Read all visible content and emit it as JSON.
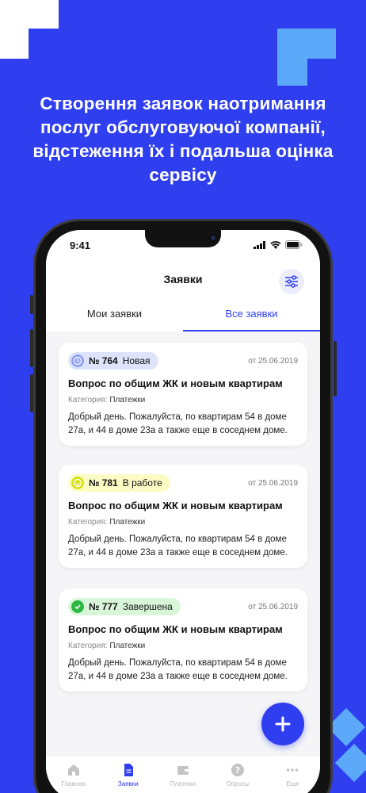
{
  "headline": "Створення заявок наотримання послуг обслуговуючої компанії, відстеження їх і подальша оцінка сервісу",
  "status": {
    "time": "9:41"
  },
  "header": {
    "title": "Заявки"
  },
  "tabs": [
    {
      "label": "Мои заявки",
      "active": false
    },
    {
      "label": "Все заявки",
      "active": true
    }
  ],
  "requests": [
    {
      "number": "№ 764",
      "status": "Новая",
      "status_color": "#dde3fb",
      "icon": "clock-icon",
      "date": "от 25.06.2019",
      "title": "Вопрос по общим ЖК и новым квартирам",
      "category_label": "Категория:",
      "category": "Платежки",
      "text": "Добрый день. Пожалуйста, по квартирам 54 в доме 27а, и 44 в доме 23а а также еще в соседнем доме."
    },
    {
      "number": "№ 781",
      "status": "В работе",
      "status_color": "#fbfcc4",
      "icon": "smile-icon",
      "date": "от 25.06.2019",
      "title": "Вопрос по общим ЖК и новым квартирам",
      "category_label": "Категория:",
      "category": "Платежки",
      "text": "Добрый день. Пожалуйста, по квартирам 54 в доме 27а, и 44 в доме 23а а также еще в соседнем доме."
    },
    {
      "number": "№ 777",
      "status": "Завершена",
      "status_color": "#d9f6d9",
      "icon": "check-icon",
      "date": "от 25.06.2019",
      "title": "Вопрос по общим ЖК и новым квартирам",
      "category_label": "Категория:",
      "category": "Платежки",
      "text": "Добрый день. Пожалуйста, по квартирам 54 в доме 27а, и 44 в доме 23а а также еще в соседнем доме."
    }
  ],
  "bottom_nav": [
    {
      "label": "Главная",
      "icon": "home-icon"
    },
    {
      "label": "Заявки",
      "icon": "document-icon",
      "active": true
    },
    {
      "label": "Платежи",
      "icon": "wallet-icon"
    },
    {
      "label": "Опросы",
      "icon": "question-icon"
    },
    {
      "label": "Еще",
      "icon": "more-icon"
    }
  ],
  "colors": {
    "brand": "#2f3ff0",
    "accent_light": "#5ba9f8"
  }
}
